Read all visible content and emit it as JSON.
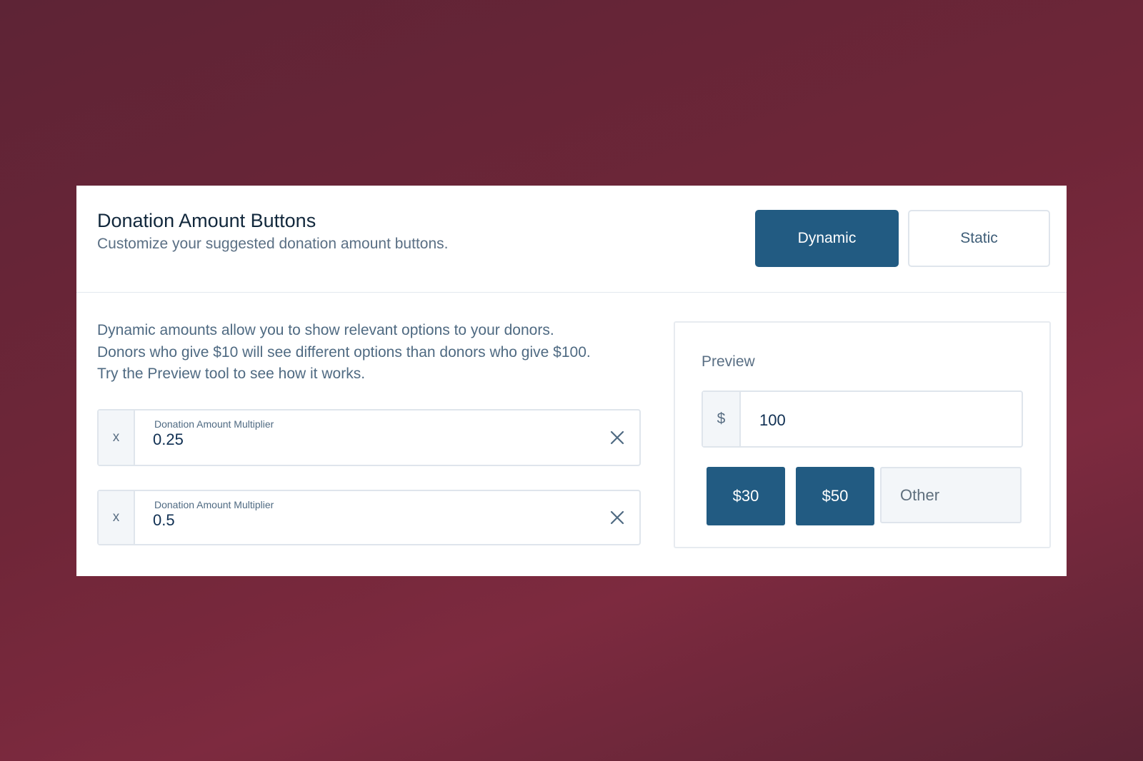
{
  "header": {
    "title": "Donation Amount Buttons",
    "subtitle": "Customize your suggested donation amount buttons."
  },
  "mode_toggle": {
    "options": [
      "Dynamic",
      "Static"
    ],
    "selected": "Dynamic"
  },
  "description": [
    "Dynamic amounts allow you to show relevant options to your donors.",
    "Donors who give $10 will see different options than donors who give $100.",
    "Try the Preview tool to see how it works."
  ],
  "multipliers": [
    {
      "prefix": "x",
      "label": "Donation Amount Multiplier",
      "value": "0.25"
    },
    {
      "prefix": "x",
      "label": "Donation Amount Multiplier",
      "value": "0.5"
    }
  ],
  "preview": {
    "label": "Preview",
    "currency_prefix": "$",
    "amount": "100",
    "buttons": [
      "$30",
      "$50"
    ],
    "other_label": "Other"
  },
  "colors": {
    "accent": "#225b82",
    "background": "#6f2638",
    "card": "#ffffff"
  },
  "icons": {
    "clear": "close-icon"
  }
}
